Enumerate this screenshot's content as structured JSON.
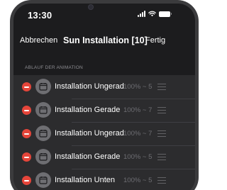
{
  "status_bar": {
    "time": "13:30"
  },
  "nav": {
    "cancel_label": "Abbrechen",
    "title": "Sun Installation [10]",
    "done_label": "Fertig"
  },
  "section": {
    "header": "ABLAUF DER ANIMATION"
  },
  "items": [
    {
      "label": "Installation Ungerad",
      "value": "100% ~ 5",
      "icon": "calendar-icon"
    },
    {
      "label": "Installation Gerade",
      "value": "100% ~ 7",
      "icon": "calendar-icon"
    },
    {
      "label": "Installation Ungerad",
      "value": "100% ~ 7",
      "icon": "calendar-icon"
    },
    {
      "label": "Installation Gerade",
      "value": "100% ~ 5",
      "icon": "calendar-icon"
    },
    {
      "label": "Installation Unten",
      "value": "100% ~ 5",
      "icon": "calendar-icon"
    }
  ],
  "colors": {
    "delete": "#e5453a",
    "background": "#1c1c1e",
    "row": "#2c2c2e"
  }
}
